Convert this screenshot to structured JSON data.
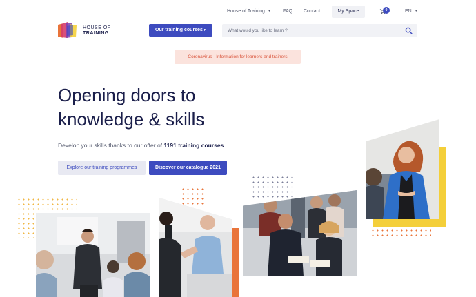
{
  "topnav": {
    "house_of_training": "House of Training",
    "faq": "FAQ",
    "contact": "Contact",
    "my_space": "My Space",
    "cart_count": "0",
    "language": "EN"
  },
  "brand": {
    "line1": "HOUSE OF",
    "line2": "TRAINING"
  },
  "search": {
    "courses_button": "Our training courses",
    "placeholder": "What would you like to learn ?"
  },
  "notice": "Coronavirus - Information for learners and trainers",
  "hero": {
    "headline_line1": "Opening doors to",
    "headline_line2": "knowledge & skills",
    "subtext_before": "Develop your skills thanks to our offer of ",
    "subtext_bold": "1191 training courses",
    "subtext_after": ".",
    "btn_explore": "Explore our training programmes",
    "btn_catalogue": "Discover our catalogue 2021"
  },
  "colors": {
    "primary": "#3d4bbf",
    "accent_orange": "#e9743a",
    "accent_yellow": "#f4cf3a",
    "notice_bg": "#fbe3dd",
    "notice_text": "#d9543b"
  },
  "icons": [
    "caret-down-icon",
    "cart-icon",
    "search-icon"
  ]
}
